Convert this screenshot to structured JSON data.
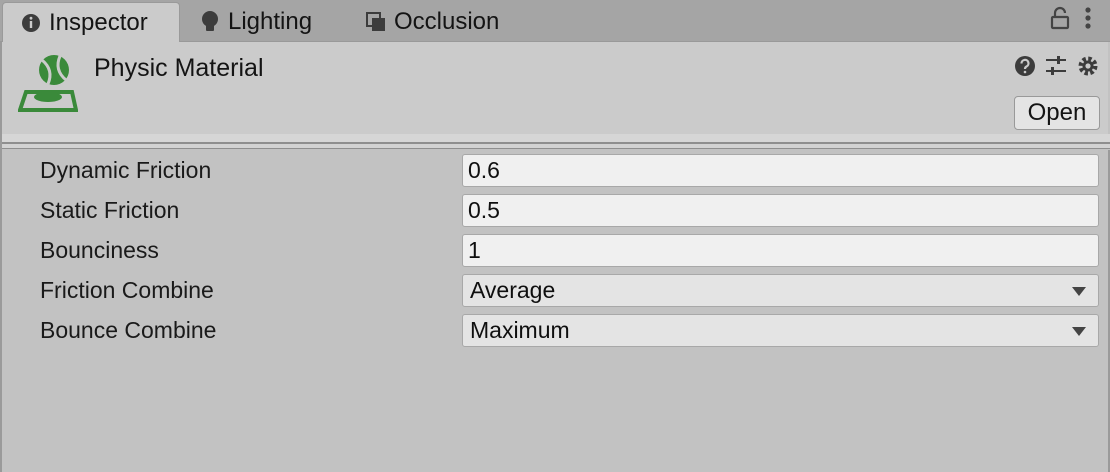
{
  "tabs": [
    {
      "label": "Inspector",
      "icon": "info-icon",
      "active": true
    },
    {
      "label": "Lighting",
      "icon": "lightbulb-icon",
      "active": false
    },
    {
      "label": "Occlusion",
      "icon": "occlusion-icon",
      "active": false
    }
  ],
  "tabbar_actions": {
    "lock_icon": "lock-icon",
    "menu_icon": "kebab-menu-icon"
  },
  "header": {
    "title": "Physic Material",
    "asset_icon": "physic-material-icon",
    "icons": [
      "help-icon",
      "presets-icon",
      "settings-gear-icon"
    ],
    "open_label": "Open",
    "accent_color": "#3a8a3a"
  },
  "properties": [
    {
      "label": "Dynamic Friction",
      "type": "float",
      "value": "0.6"
    },
    {
      "label": "Static Friction",
      "type": "float",
      "value": "0.5"
    },
    {
      "label": "Bounciness",
      "type": "float",
      "value": "1"
    },
    {
      "label": "Friction Combine",
      "type": "enum",
      "value": "Average"
    },
    {
      "label": "Bounce Combine",
      "type": "enum",
      "value": "Maximum"
    }
  ]
}
